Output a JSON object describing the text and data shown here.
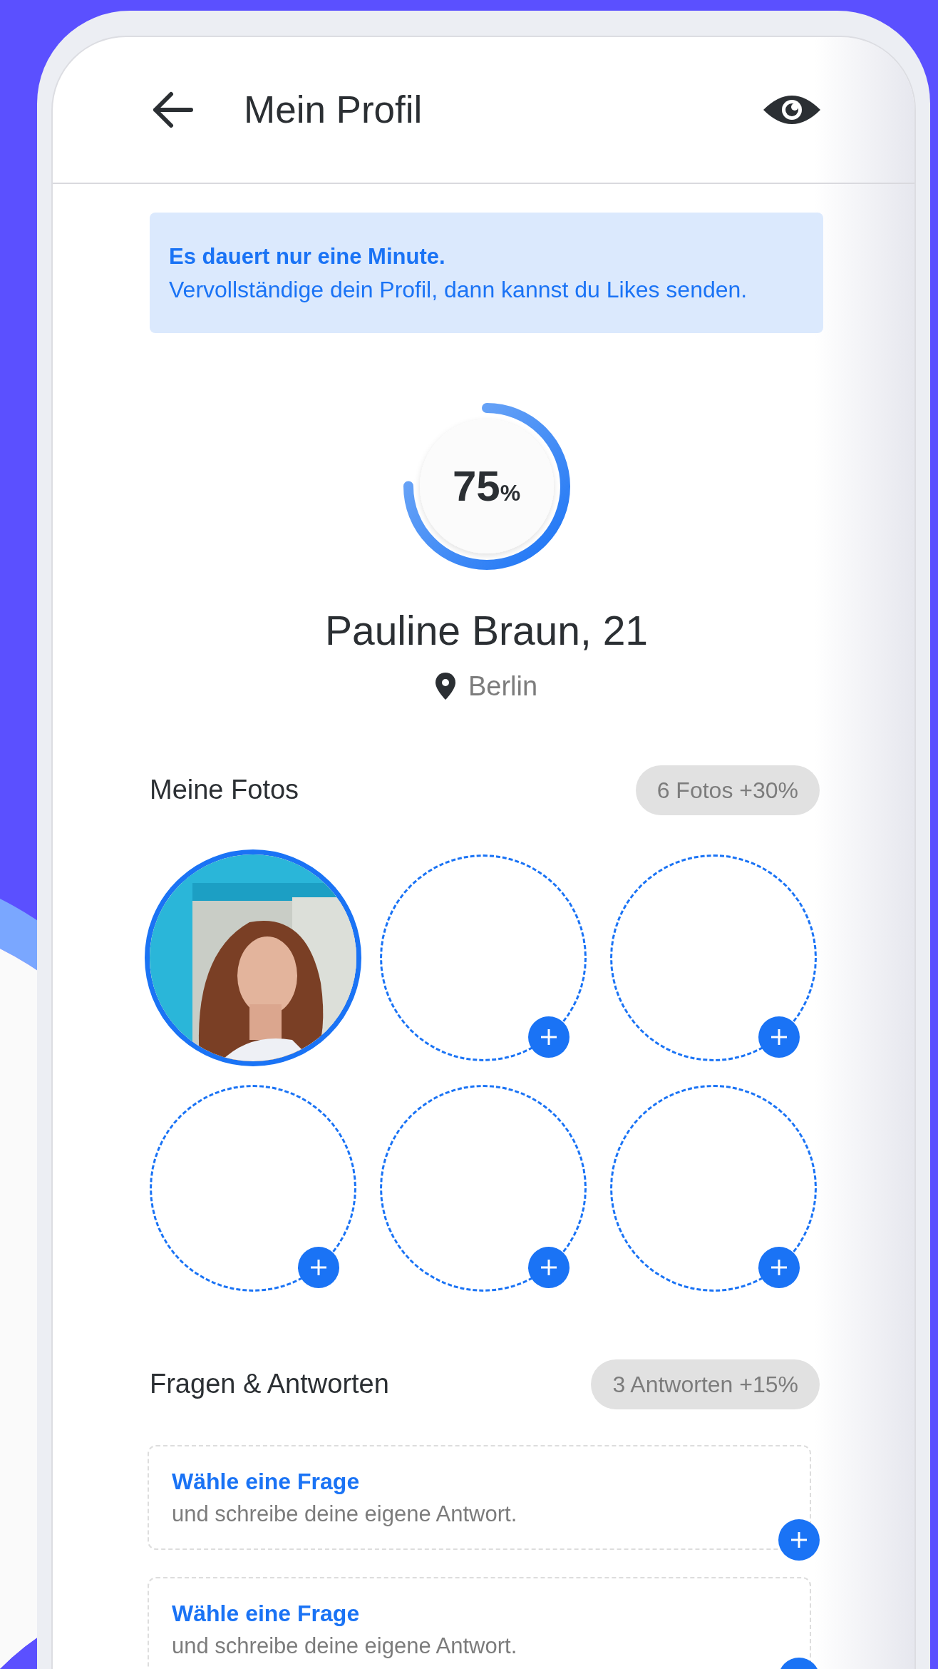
{
  "header": {
    "title": "Mein Profil"
  },
  "banner": {
    "title": "Es dauert nur eine Minute.",
    "text": "Vervollständige dein Profil, dann kannst du Likes senden."
  },
  "progress": {
    "value": "75",
    "unit": "%",
    "level": 0.75
  },
  "profile": {
    "name": "Pauline Braun, 21",
    "location": "Berlin"
  },
  "photos": {
    "title": "Meine Fotos",
    "badge": "6 Fotos +30%",
    "slots": [
      {
        "kind": "picture"
      },
      {
        "kind": "empty"
      },
      {
        "kind": "empty"
      },
      {
        "kind": "empty"
      },
      {
        "kind": "empty"
      },
      {
        "kind": "empty"
      }
    ]
  },
  "questions": {
    "title": "Fragen & Antworten",
    "badge": "3 Antworten +15%",
    "cards": [
      {
        "title": "Wähle eine Frage",
        "text": "und schreibe deine eigene Antwort."
      },
      {
        "title": "Wähle eine Frage",
        "text": "und schreibe deine eigene Antwort."
      }
    ]
  }
}
